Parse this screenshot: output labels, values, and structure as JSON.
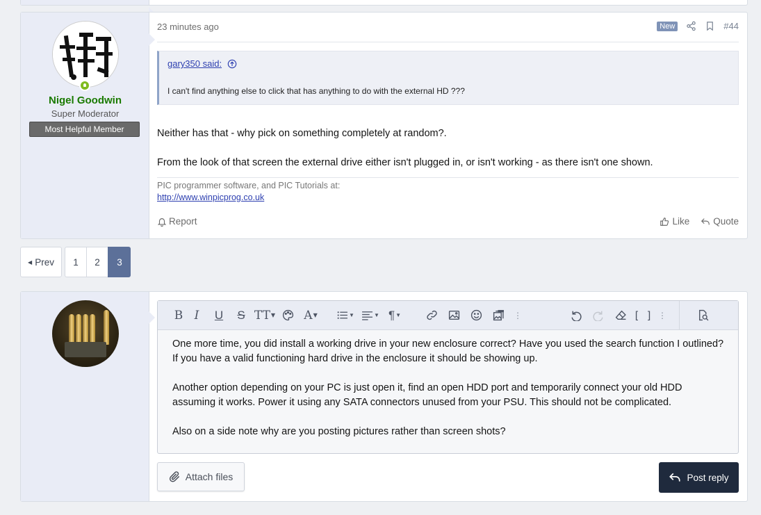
{
  "post": {
    "username": "Nigel Goodwin",
    "user_title": "Super Moderator",
    "user_banner": "Most Helpful Member",
    "time": "23 minutes ago",
    "new_badge": "New",
    "post_number": "#44",
    "quote": {
      "author": "gary350 said:",
      "text": "I can't find anything else to click that has anything to do with the external HD ???"
    },
    "message": [
      "Neither has that - why pick on something completely at random?.",
      "From the look of that screen the external drive either isn't plugged in, or isn't working - as there isn't one shown."
    ],
    "signature": {
      "text": "PIC programmer software, and PIC Tutorials at:",
      "link": "http://www.winpicprog.co.uk"
    },
    "actions": {
      "report": "Report",
      "like": "Like",
      "quote": "Quote"
    }
  },
  "pagination": {
    "prev": "Prev",
    "pages": [
      "1",
      "2",
      "3"
    ],
    "current": "3"
  },
  "reply": {
    "editor_text": [
      "One more time, you did install a working drive in your new enclosure correct? Have you used the search function I outlined? If you have a valid functioning hard drive in the enclosure it should be showing up.",
      "Another option depending on your PC is just open it, find an open HDD port and temporarily connect your old HDD assuming it works. Power it using any SATA connectors unused from your PSU. This should not be complicated.",
      "Also on a side note why are you posting pictures rather than screen shots?"
    ],
    "attach_label": "Attach files",
    "post_label": "Post reply"
  },
  "colors": {
    "username": "#1a7a00",
    "accent": "#5c7099",
    "post_button": "#1f2a3d",
    "new_badge": "#7f93b7"
  }
}
